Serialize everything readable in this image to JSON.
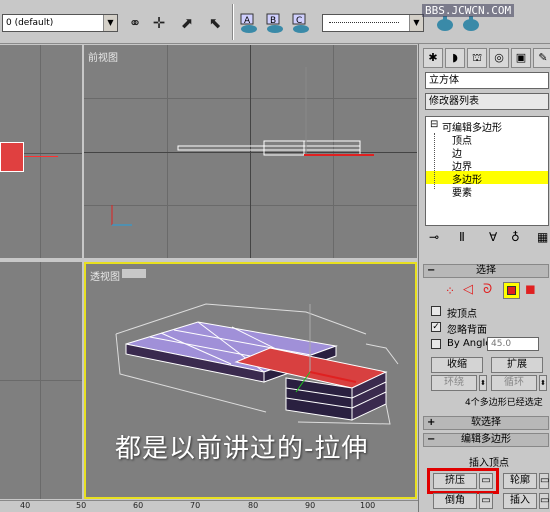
{
  "toolbar": {
    "layer_combo": "0 (default)",
    "selection_combo": "",
    "watermark": "BBS.JCWCN.COM",
    "icons": [
      "link-icon",
      "unlink-icon",
      "select-move-icon",
      "select-rotate-icon",
      "select-region-icon",
      "render-a-icon",
      "render-b-icon",
      "render-c-icon",
      "teapot-icon"
    ]
  },
  "viewports": {
    "front": {
      "label": "前视图"
    },
    "perspective": {
      "label": "透视图"
    }
  },
  "ruler": {
    "ticks": [
      "40",
      "50",
      "60",
      "70",
      "80",
      "90",
      "100"
    ]
  },
  "panel": {
    "object_name": "立方体",
    "modifier_list": "修改器列表",
    "stack": {
      "root": "可编辑多边形",
      "items": [
        "顶点",
        "边",
        "边界",
        "多边形",
        "要素"
      ],
      "selected_index": 3
    },
    "selection_rollout": {
      "title": "选择",
      "by_vertex": "按顶点",
      "ignore_backfacing": "忽略背面",
      "by_angle": "By Angle:",
      "angle_value": "45.0",
      "shrink": "收缩",
      "grow": "扩展",
      "ring": "环绕",
      "loop": "循环",
      "status": "4个多边形已经选定"
    },
    "soft_selection": {
      "title": "软选择"
    },
    "edit_polygons": {
      "title": "编辑多边形",
      "insert_vertex": "插入顶点",
      "extrude": "挤压",
      "outline": "轮廓",
      "bevel": "倒角",
      "inset": "插入"
    }
  },
  "caption": "都是以前讲过的-拉伸",
  "colors": {
    "selection_highlight": "#ff0000",
    "polygon_fill": "#a090d8",
    "selected_stack": "#ffff00"
  }
}
